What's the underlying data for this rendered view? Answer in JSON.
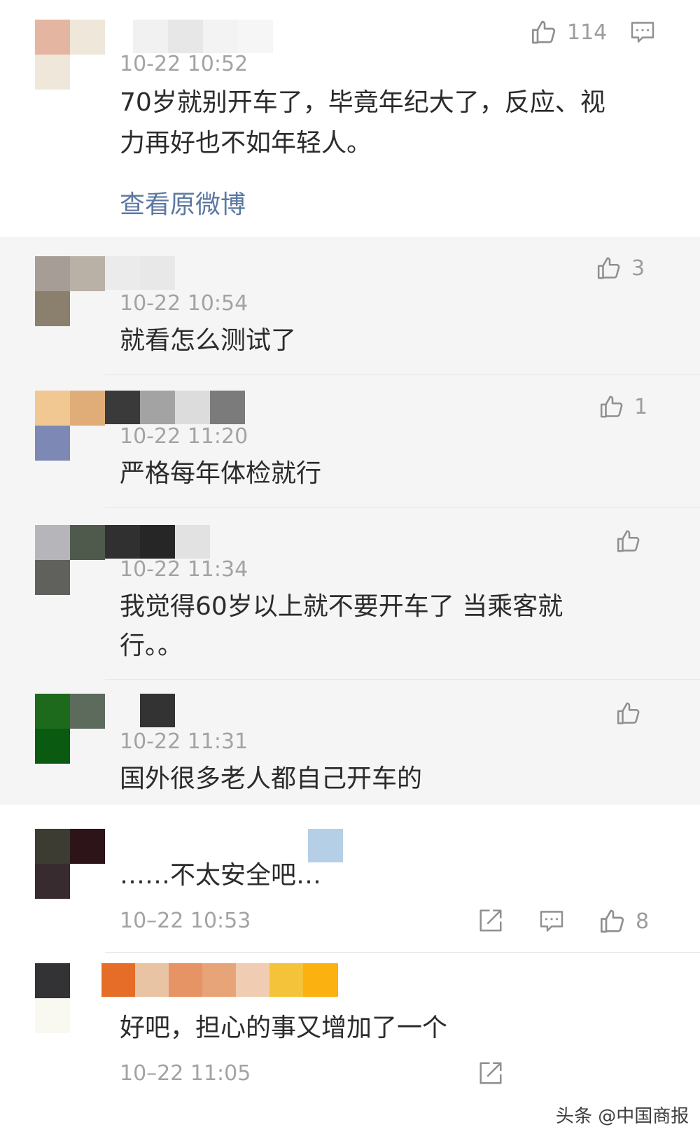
{
  "comments": [
    {
      "time": "10-22 10:52",
      "text_line1": "70岁就别开车了，毕竟年纪大了，反应、视",
      "text_line2": "力再好也不如年轻人。",
      "likes": "114",
      "view_original": "查看原微博",
      "icon": "thumbs-up-icon",
      "reply_icon": "comment-icon"
    },
    {
      "time": "10-22 10:54",
      "text": "就看怎么测试了",
      "likes": "3",
      "icon": "thumbs-up-icon"
    },
    {
      "time": "10-22 11:20",
      "text": "严格每年体检就行",
      "likes": "1",
      "icon": "thumbs-up-icon"
    },
    {
      "time": "10-22 11:34",
      "text_line1": "我觉得60岁以上就不要开车了 当乘客就",
      "text_line2": "行。。",
      "icon": "thumbs-up-icon"
    },
    {
      "time": "10-22 11:31",
      "text": "国外很多老人都自己开车的",
      "icon": "thumbs-up-icon"
    },
    {
      "time": "10–22 10:53",
      "text": "……不太安全吧…",
      "likes": "8",
      "icons": [
        "share-icon",
        "comment-icon",
        "thumbs-up-icon"
      ]
    },
    {
      "time": "10–22 11:05",
      "text": "好吧，担心的事又增加了一个",
      "icons": [
        "share-icon"
      ]
    }
  ],
  "watermark": "头条 @中国商报",
  "colors": {
    "panel_bg": "#f5f5f5",
    "link": "#5b78a1",
    "time": "#a3a3a3",
    "text": "#2b2b2b"
  }
}
